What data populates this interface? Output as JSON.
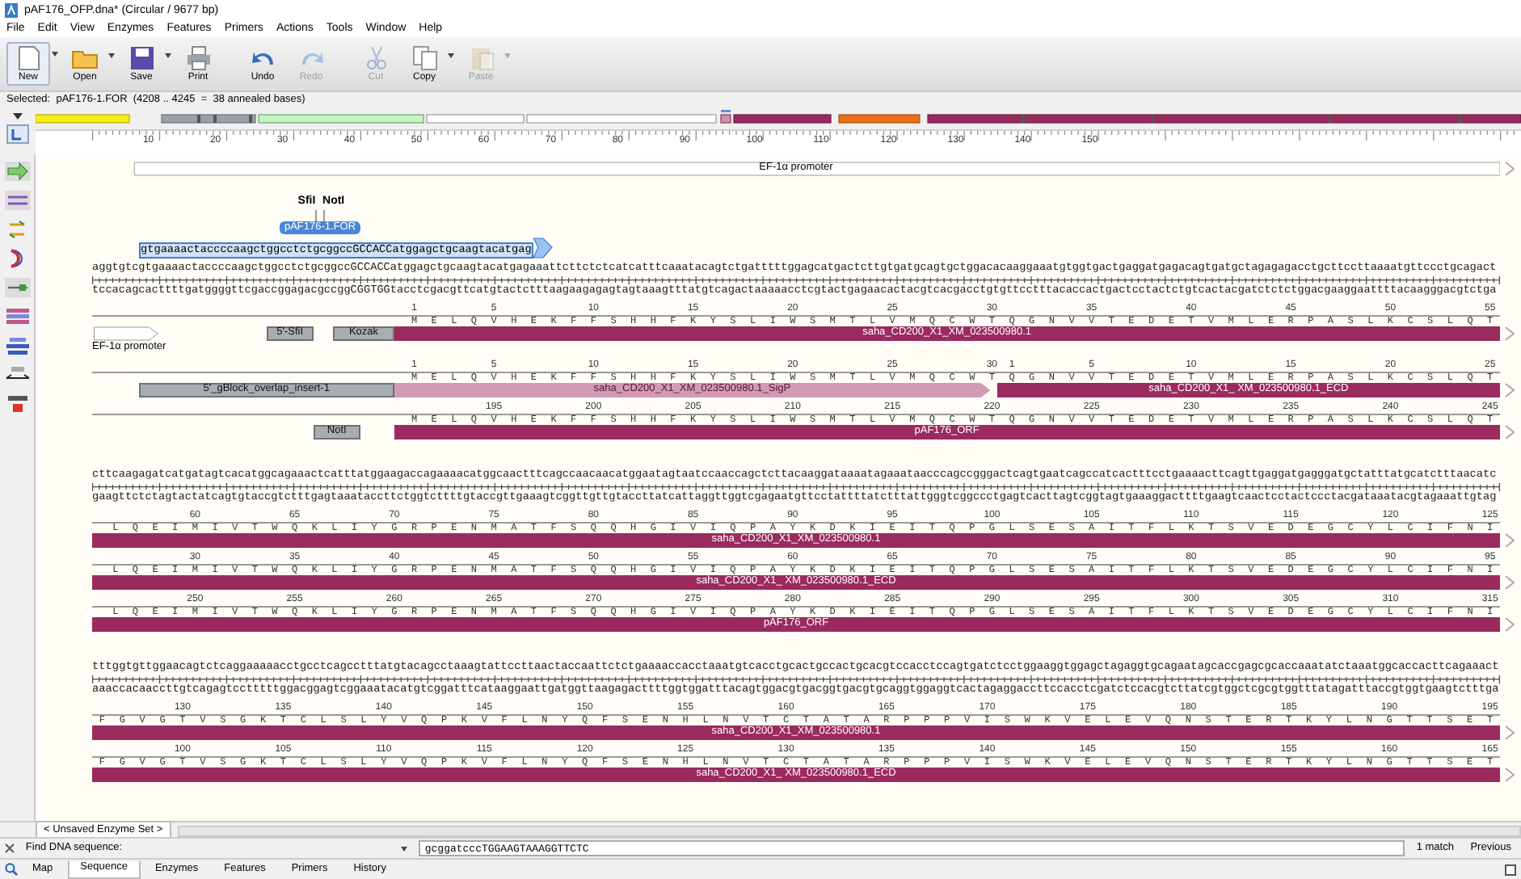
{
  "window": {
    "title": "pAF176_OFP.dna*  (Circular / 9677 bp)"
  },
  "menu": [
    "File",
    "Edit",
    "View",
    "Enzymes",
    "Features",
    "Primers",
    "Actions",
    "Tools",
    "Window",
    "Help"
  ],
  "toolbar": [
    {
      "kind": "new",
      "label": "New",
      "disabled": false,
      "dropdown": true
    },
    {
      "kind": "open",
      "label": "Open",
      "disabled": false,
      "dropdown": true
    },
    {
      "kind": "save",
      "label": "Save",
      "disabled": false,
      "dropdown": true
    },
    {
      "kind": "print",
      "label": "Print",
      "disabled": false,
      "dropdown": false
    },
    {
      "kind": "undo",
      "label": "Undo",
      "disabled": false,
      "dropdown": false
    },
    {
      "kind": "redo",
      "label": "Redo",
      "disabled": true,
      "dropdown": false
    },
    {
      "kind": "cut",
      "label": "Cut",
      "disabled": true,
      "dropdown": false
    },
    {
      "kind": "copy",
      "label": "Copy",
      "disabled": false,
      "dropdown": true
    },
    {
      "kind": "paste",
      "label": "Paste",
      "disabled": true,
      "dropdown": true
    }
  ],
  "selection_info": "Selected:  pAF176-1.FOR  (4208 .. 4245  =  38 annealed bases)",
  "map_ruler": [
    "10",
    "20",
    "30",
    "40",
    "50",
    "60",
    "70",
    "80",
    "90",
    "100",
    "110",
    "120",
    "130",
    "140",
    "150"
  ],
  "blocks": [
    {
      "above": [
        {
          "kind": "promoter",
          "label": "EF-1α promoter",
          "continues": true
        }
      ],
      "enzymes": [
        "SfiI",
        "NotI"
      ],
      "primer": {
        "label": "pAF176-1.FOR",
        "sequence": "gtgaaaactaccccaagctggcctctgcggccGCCACCatggagctgcaagtacatgag",
        "selected": true
      },
      "top_strand": "aggtgtcgtgaaaactaccccaagctggcctctgcggccGCCACCatggagctgcaagtacatgagaaattcttctctcatcatttcaaatacagtctgatttttggagcatgactcttgtgatgcagtgctggacacaaggaaatgtggtgactgaggatgagacagtgatgctagagagacctgcttccttaaaatgttccctgcagact",
      "bottom_strand": "tccacagcacttttgatggggttcgaccggagacgccggCGGTGGtacctcgacgttcatgtactctttaagaagagagtagtaaagtttatgtcagactaaaaacctcgtactgagaacactacgtcacgacctgtgttcctttacaccactgactcctactctgtcactacgatctctctggacgaaggaattttacaagggacgtctga",
      "tracks": [
        {
          "residues": [
            {
              "aa": "M",
              "num": "1"
            },
            {
              "aa": "ELQV",
              "num": "5"
            },
            {
              "aa": "HEKFF",
              "num": "10"
            },
            {
              "aa": "SHHFK",
              "num": "15"
            },
            {
              "aa": "YSLIW",
              "num": "20"
            },
            {
              "aa": "SMTLV",
              "num": "25"
            },
            {
              "aa": "MQCWT",
              "num": "30"
            },
            {
              "aa": "QGNVV",
              "num": "35"
            },
            {
              "aa": "TEDET",
              "num": "40"
            },
            {
              "aa": "VMLER",
              "num": "45"
            },
            {
              "aa": "PASLK",
              "num": "50"
            },
            {
              "aa": "CSLQT",
              "num": "55"
            }
          ],
          "features": [
            {
              "kind": "promoter",
              "label": "EF-1α promoter",
              "continues": false
            },
            {
              "kind": "misc",
              "label": "5'-SfiI",
              "continues": false
            },
            {
              "kind": "misc",
              "label": "Kozak",
              "continues": false
            },
            {
              "kind": "cds",
              "label": "saha_CD200_X1_XM_023500980.1",
              "continues": true
            }
          ]
        },
        {
          "residues": [
            {
              "aa": "M",
              "num": "1"
            },
            {
              "aa": "ELQV",
              "num": "5"
            },
            {
              "aa": "HEKFF",
              "num": "10"
            },
            {
              "aa": "SHHFK",
              "num": "15"
            },
            {
              "aa": "YSLIW",
              "num": "20"
            },
            {
              "aa": "SMTLV",
              "num": "25"
            },
            {
              "aa": "MQCWT",
              "num": "30"
            },
            {
              "aa": "Q",
              "num": "1"
            },
            {
              "aa": "GNVV",
              "num": "5"
            },
            {
              "aa": "TEDET",
              "num": "10"
            },
            {
              "aa": "VMLER",
              "num": "15"
            },
            {
              "aa": "PASLK",
              "num": "20"
            },
            {
              "aa": "CSLQT",
              "num": "25"
            }
          ],
          "features": [
            {
              "kind": "misc",
              "label": "5'_gBlock_overlap_insert-1",
              "continues": false
            },
            {
              "kind": "signal",
              "label": "saha_CD200_X1_XM_023500980.1_SigP",
              "continues": false
            },
            {
              "kind": "cds",
              "label": "saha_CD200_X1_ XM_023500980.1_ECD",
              "continues": true
            }
          ]
        },
        {
          "residues": [
            {
              "aa": "MELQV",
              "num": "195"
            },
            {
              "aa": "HEKFF",
              "num": "200"
            },
            {
              "aa": "SHHFK",
              "num": "205"
            },
            {
              "aa": "YSLIW",
              "num": "210"
            },
            {
              "aa": "SMTLV",
              "num": "215"
            },
            {
              "aa": "MQCWT",
              "num": "220"
            },
            {
              "aa": "QGNVV",
              "num": "225"
            },
            {
              "aa": "TEDET",
              "num": "230"
            },
            {
              "aa": "VMLER",
              "num": "235"
            },
            {
              "aa": "PASLK",
              "num": "240"
            },
            {
              "aa": "CSLQT",
              "num": "245"
            }
          ],
          "features": [
            {
              "kind": "misc",
              "label": "NotI",
              "continues": false
            },
            {
              "kind": "cds",
              "label": "pAF176_ORF",
              "continues": true
            }
          ]
        }
      ]
    },
    {
      "top_strand": "cttcaagagatcatgatagtcacatggcagaaactcatttatggaagaccagaaaacatggcaactttcagccaacaacatggaatagtaatccaaccagctcttacaaggataaaatagaaataacccagccgggactcagtgaatcagccatcactttcctgaaaacttcagttgaggatgagggatgctatttatgcatctttaacatc",
      "bottom_strand": "gaagttctctagtactatcagtgtaccgtctttgagtaaataccttctggtcttttgtaccgttgaaagtcggttgttgtaccttatcattaggttggtcgagaatgttcctattttatctttattgggtcggccctgagtcacttagtcggtagtgaaaggacttttgaagtcaactcctactccctacgataaatacgtagaaattgtag",
      "tracks": [
        {
          "residues": [
            {
              "aa": "LQEIM",
              "num": "60"
            },
            {
              "aa": "IVTWQ",
              "num": "65"
            },
            {
              "aa": "KLIYG",
              "num": "70"
            },
            {
              "aa": "RPENM",
              "num": "75"
            },
            {
              "aa": "ATFSQ",
              "num": "80"
            },
            {
              "aa": "QHGIV",
              "num": "85"
            },
            {
              "aa": "IQPAY",
              "num": "90"
            },
            {
              "aa": "KDKIE",
              "num": "95"
            },
            {
              "aa": "ITQPG",
              "num": "100"
            },
            {
              "aa": "LSESA",
              "num": "105"
            },
            {
              "aa": "ITFLK",
              "num": "110"
            },
            {
              "aa": "TSVED",
              "num": "115"
            },
            {
              "aa": "EGCYL",
              "num": "120"
            },
            {
              "aa": "CIFNI",
              "num": "125"
            }
          ],
          "features": [
            {
              "kind": "cds",
              "label": "saha_CD200_X1_XM_023500980.1",
              "continues": true
            }
          ]
        },
        {
          "residues": [
            {
              "aa": "LQEIM",
              "num": "30"
            },
            {
              "aa": "IVTWQ",
              "num": "35"
            },
            {
              "aa": "KLIYG",
              "num": "40"
            },
            {
              "aa": "RPENM",
              "num": "45"
            },
            {
              "aa": "ATFSQ",
              "num": "50"
            },
            {
              "aa": "QHGIV",
              "num": "55"
            },
            {
              "aa": "IQPAY",
              "num": "60"
            },
            {
              "aa": "KDKIE",
              "num": "65"
            },
            {
              "aa": "ITQPG",
              "num": "70"
            },
            {
              "aa": "LSESA",
              "num": "75"
            },
            {
              "aa": "ITFLK",
              "num": "80"
            },
            {
              "aa": "TSVED",
              "num": "85"
            },
            {
              "aa": "EGCYL",
              "num": "90"
            },
            {
              "aa": "CIFNI",
              "num": "95"
            }
          ],
          "features": [
            {
              "kind": "cds",
              "label": "saha_CD200_X1_ XM_023500980.1_ECD",
              "continues": true
            }
          ]
        },
        {
          "residues": [
            {
              "aa": "LQEIM",
              "num": "250"
            },
            {
              "aa": "IVTWQ",
              "num": "255"
            },
            {
              "aa": "KLIYG",
              "num": "260"
            },
            {
              "aa": "RPENM",
              "num": "265"
            },
            {
              "aa": "ATFSQ",
              "num": "270"
            },
            {
              "aa": "QHGIV",
              "num": "275"
            },
            {
              "aa": "IQPAY",
              "num": "280"
            },
            {
              "aa": "KDKIE",
              "num": "285"
            },
            {
              "aa": "ITQPG",
              "num": "290"
            },
            {
              "aa": "LSESA",
              "num": "295"
            },
            {
              "aa": "ITFLK",
              "num": "300"
            },
            {
              "aa": "TSVED",
              "num": "305"
            },
            {
              "aa": "EGCYL",
              "num": "310"
            },
            {
              "aa": "CIFNI",
              "num": "315"
            }
          ],
          "features": [
            {
              "kind": "cds",
              "label": "pAF176_ORF",
              "continues": true
            }
          ]
        }
      ]
    },
    {
      "top_strand": "tttggtgttggaacagtctcaggaaaaacctgcctcagcctttatgtacagcctaaagtattccttaactaccaattctctgaaaaccacctaaatgtcacctgcactgccactgcacgtccacctccagtgatctcctggaaggtggagctagaggtgcagaatagcaccgagcgcaccaaatatctaaatggcaccacttcagaaact",
      "bottom_strand": "aaaccacaaccttgtcagagtcctttttggacggagtcggaaatacatgtcggatttcataaggaattgatggttaagagacttttggtggatttacagtggacgtgacggtgacgtgcaggtggaggtcactagaggaccttccacctcgatctccacgtcttatcgtggctcgcgtggtttatagatttaccgtggtgaagtctttga",
      "tracks": [
        {
          "residues": [
            {
              "aa": "FGVGT",
              "num": "130"
            },
            {
              "aa": "VSGKT",
              "num": "135"
            },
            {
              "aa": "CLSLY",
              "num": "140"
            },
            {
              "aa": "VQPKV",
              "num": "145"
            },
            {
              "aa": "FLNYQ",
              "num": "150"
            },
            {
              "aa": "FSENH",
              "num": "155"
            },
            {
              "aa": "LNVTC",
              "num": "160"
            },
            {
              "aa": "TATAR",
              "num": "165"
            },
            {
              "aa": "PPPVI",
              "num": "170"
            },
            {
              "aa": "SWKVE",
              "num": "175"
            },
            {
              "aa": "LEVQN",
              "num": "180"
            },
            {
              "aa": "STERT",
              "num": "185"
            },
            {
              "aa": "KYLNG",
              "num": "190"
            },
            {
              "aa": "TTSET",
              "num": "195"
            }
          ],
          "features": [
            {
              "kind": "cds",
              "label": "saha_CD200_X1_XM_023500980.1",
              "continues": true
            }
          ]
        },
        {
          "residues": [
            {
              "aa": "FGVGT",
              "num": "100"
            },
            {
              "aa": "VSGKT",
              "num": "105"
            },
            {
              "aa": "CLSLY",
              "num": "110"
            },
            {
              "aa": "VQPKV",
              "num": "115"
            },
            {
              "aa": "FLNYQ",
              "num": "120"
            },
            {
              "aa": "FSENH",
              "num": "125"
            },
            {
              "aa": "LNVTC",
              "num": "130"
            },
            {
              "aa": "TATAR",
              "num": "135"
            },
            {
              "aa": "PPPVI",
              "num": "140"
            },
            {
              "aa": "SWKVE",
              "num": "145"
            },
            {
              "aa": "LEVQN",
              "num": "150"
            },
            {
              "aa": "STERT",
              "num": "155"
            },
            {
              "aa": "KYLNG",
              "num": "160"
            },
            {
              "aa": "TTSET",
              "num": "165"
            }
          ],
          "features": [
            {
              "kind": "cds",
              "label": "saha_CD200_X1_ XM_023500980.1_ECD",
              "continues": true
            }
          ]
        }
      ]
    }
  ],
  "enzyme_set_tab": "< Unsaved Enzyme Set >",
  "find_bar": {
    "label": "Find DNA sequence:",
    "value": "gcggatcccTGGAAGTAAAGGTTCTC",
    "matches": "1 match",
    "previous": "Previous"
  },
  "view_tabs": [
    {
      "label": "Map",
      "selected": false
    },
    {
      "label": "Sequence",
      "selected": true
    },
    {
      "label": "Enzymes",
      "selected": false
    },
    {
      "label": "Features",
      "selected": false
    },
    {
      "label": "Primers",
      "selected": false
    },
    {
      "label": "History",
      "selected": false
    }
  ]
}
